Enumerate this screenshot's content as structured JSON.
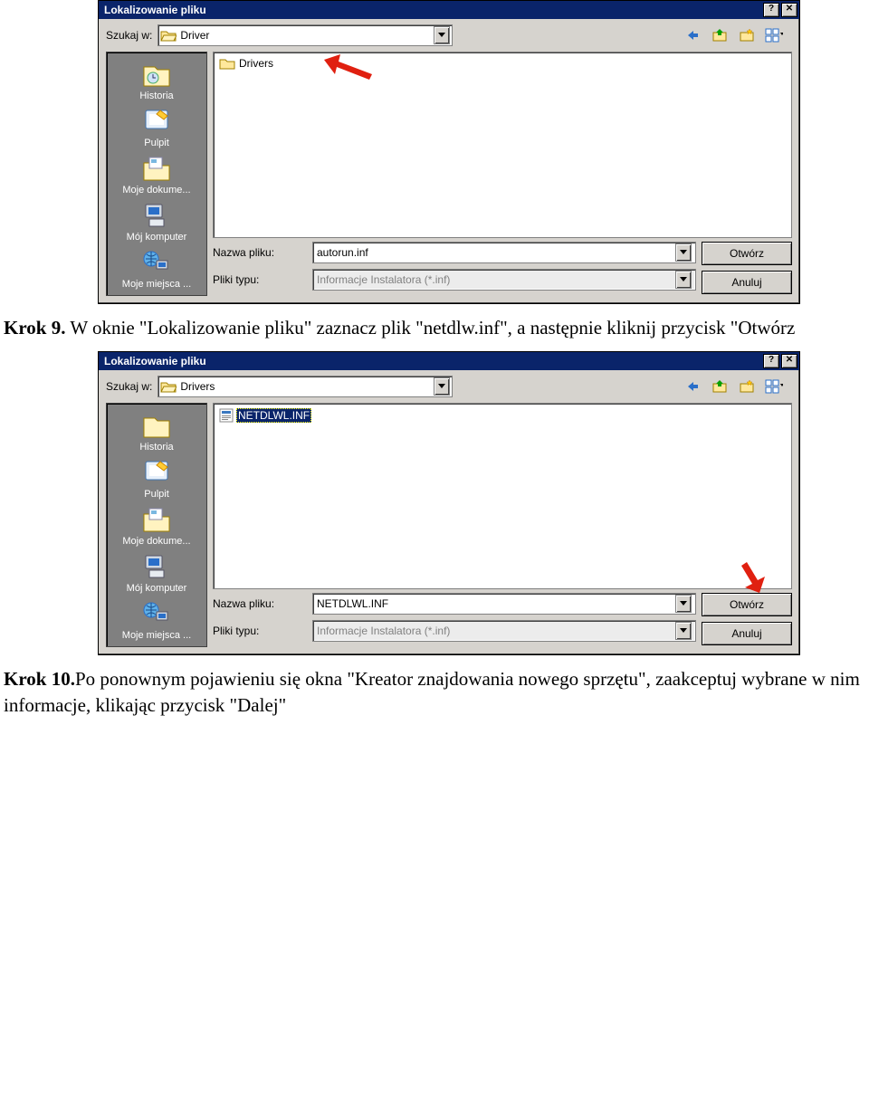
{
  "dialogs": [
    {
      "title": "Lokalizowanie pliku",
      "look_in_label": "Szukaj w:",
      "look_in_value": "Driver",
      "sidebar": [
        "Historia",
        "Pulpit",
        "Moje dokume...",
        "Mój komputer",
        "Moje miejsca ..."
      ],
      "file_item": "Drivers",
      "file_selected": false,
      "filename_label": "Nazwa pliku:",
      "filename_value": "autorun.inf",
      "filetype_label": "Pliki typu:",
      "filetype_value": "Informacje Instalatora (*.inf)",
      "btn_open": "Otwórz",
      "btn_cancel": "Anuluj",
      "arrow_points_to": "file_item"
    },
    {
      "title": "Lokalizowanie pliku",
      "look_in_label": "Szukaj w:",
      "look_in_value": "Drivers",
      "sidebar": [
        "Historia",
        "Pulpit",
        "Moje dokume...",
        "Mój komputer",
        "Moje miejsca ..."
      ],
      "file_item": "NETDLWL.INF",
      "file_selected": true,
      "filename_label": "Nazwa pliku:",
      "filename_value": "NETDLWL.INF",
      "filetype_label": "Pliki typu:",
      "filetype_value": "Informacje Instalatora (*.inf)",
      "btn_open": "Otwórz",
      "btn_cancel": "Anuluj",
      "arrow_points_to": "open_button"
    }
  ],
  "paragraphs": {
    "step9_bold": "Krok 9.",
    "step9_rest": " W oknie \"Lokalizowanie pliku\" zaznacz plik \"netdlw.inf\", a następnie kliknij przycisk \"Otwórz",
    "step10_bold": "Krok 10.",
    "step10_rest": "Po ponownym pojawieniu się okna \"Kreator znajdowania nowego sprzętu\", zaakceptuj wybrane w nim informacje, klikając przycisk \"Dalej\""
  }
}
